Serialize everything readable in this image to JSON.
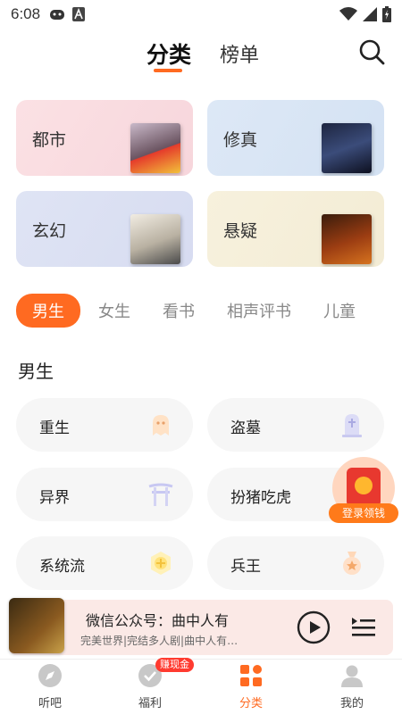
{
  "status_bar": {
    "time": "6:08"
  },
  "header": {
    "tabs": [
      {
        "label": "分类",
        "active": true
      },
      {
        "label": "榜单",
        "active": false
      }
    ]
  },
  "categories": [
    {
      "label": "都市"
    },
    {
      "label": "修真"
    },
    {
      "label": "玄幻"
    },
    {
      "label": "悬疑"
    }
  ],
  "filters": [
    {
      "label": "男生",
      "active": true
    },
    {
      "label": "女生"
    },
    {
      "label": "看书"
    },
    {
      "label": "相声评书"
    },
    {
      "label": "儿童"
    }
  ],
  "section": {
    "title": "男生"
  },
  "genres": [
    {
      "label": "重生",
      "icon": "ghost-icon"
    },
    {
      "label": "盗墓",
      "icon": "tombstone-icon"
    },
    {
      "label": "异界",
      "icon": "torii-gate-icon"
    },
    {
      "label": "扮猪吃虎",
      "icon": ""
    },
    {
      "label": "系统流",
      "icon": "coin-icon"
    },
    {
      "label": "兵王",
      "icon": "medal-icon"
    }
  ],
  "red_packet": {
    "label": "登录领钱"
  },
  "player": {
    "title": "微信公众号：曲中人有",
    "subtitle": "完美世界|完结多人剧|曲中人有…"
  },
  "bottom_nav": [
    {
      "label": "听吧",
      "icon": "compass-icon"
    },
    {
      "label": "福利",
      "icon": "check-circle-icon",
      "badge": "赚现金"
    },
    {
      "label": "分类",
      "icon": "grid-icon",
      "active": true
    },
    {
      "label": "我的",
      "icon": "user-icon"
    }
  ],
  "colors": {
    "accent": "#ff6a21",
    "badge": "#ff3b30"
  }
}
